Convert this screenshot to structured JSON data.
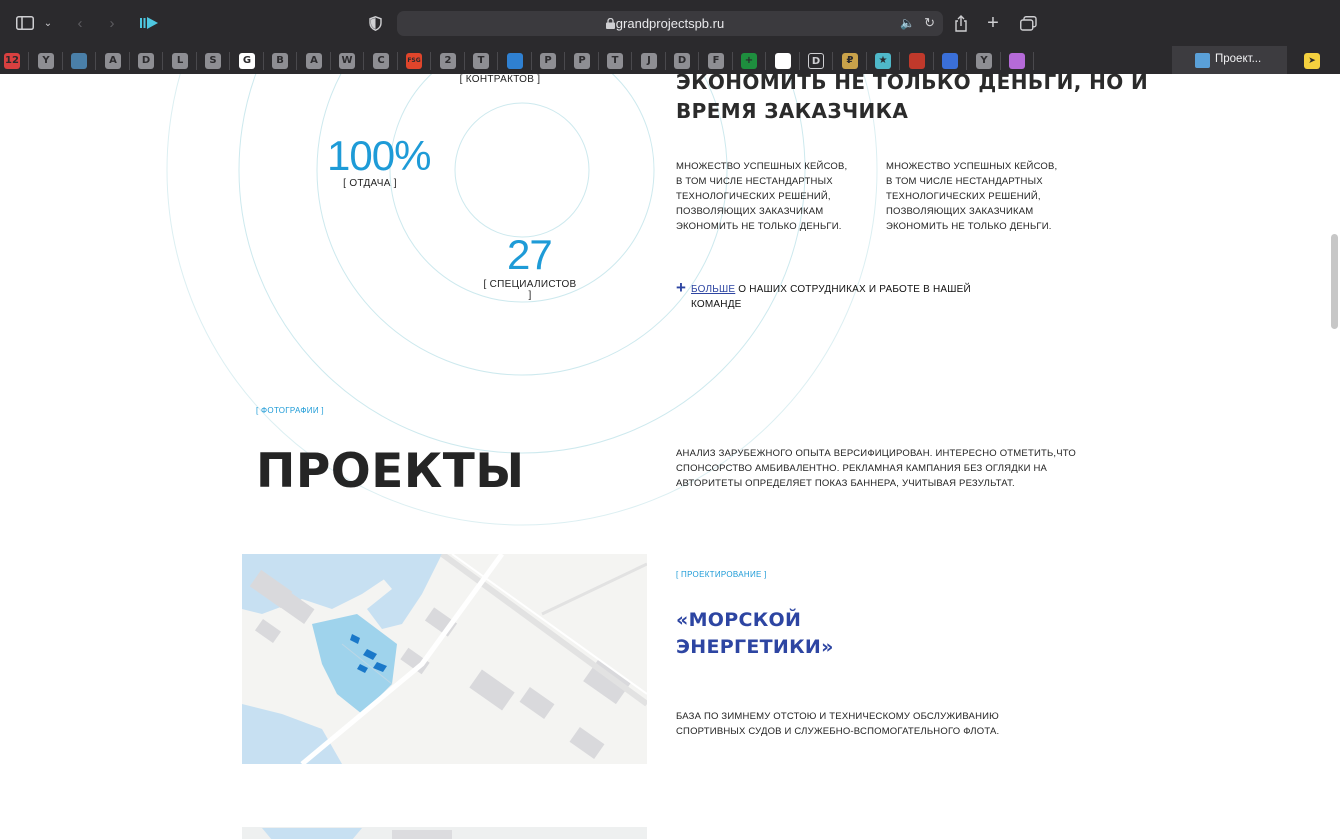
{
  "browser": {
    "url": "grandprojectspb.ru",
    "active_tab_title": "Проект...",
    "favorites": [
      {
        "icon": "favicon-12",
        "label": "12",
        "color": "#d94040"
      },
      {
        "icon": "favicon-y",
        "label": "Y",
        "color": "#8e8e93"
      },
      {
        "icon": "favicon-bird",
        "label": "",
        "color": "#4a7fa8"
      },
      {
        "icon": "favicon-a",
        "label": "A",
        "color": "#8e8e93"
      },
      {
        "icon": "favicon-d",
        "label": "D",
        "color": "#8e8e93"
      },
      {
        "icon": "favicon-l",
        "label": "L",
        "color": "#8e8e93"
      },
      {
        "icon": "favicon-s",
        "label": "S",
        "color": "#8e8e93"
      },
      {
        "icon": "favicon-google",
        "label": "G",
        "color": "#ffffff"
      },
      {
        "icon": "favicon-b",
        "label": "B",
        "color": "#8e8e93"
      },
      {
        "icon": "favicon-a2",
        "label": "A",
        "color": "#8e8e93"
      },
      {
        "icon": "favicon-w",
        "label": "W",
        "color": "#8e8e93"
      },
      {
        "icon": "favicon-c",
        "label": "C",
        "color": "#8e8e93"
      },
      {
        "icon": "favicon-fsg",
        "label": "FSG",
        "color": "#e0452b"
      },
      {
        "icon": "favicon-2",
        "label": "2",
        "color": "#8e8e93"
      },
      {
        "icon": "favicon-t",
        "label": "T",
        "color": "#8e8e93"
      },
      {
        "icon": "favicon-trello",
        "label": "",
        "color": "#2f80d1"
      },
      {
        "icon": "favicon-p",
        "label": "P",
        "color": "#8e8e93"
      },
      {
        "icon": "favicon-p2",
        "label": "P",
        "color": "#8e8e93"
      },
      {
        "icon": "favicon-t2",
        "label": "T",
        "color": "#8e8e93"
      },
      {
        "icon": "favicon-j",
        "label": "J",
        "color": "#8e8e93"
      },
      {
        "icon": "favicon-d2",
        "label": "D",
        "color": "#8e8e93"
      },
      {
        "icon": "favicon-f",
        "label": "F",
        "color": "#8e8e93"
      },
      {
        "icon": "favicon-sheets",
        "label": "+",
        "color": "#1e8e3e"
      },
      {
        "icon": "favicon-whatsapp",
        "label": "",
        "color": "#ffffff"
      },
      {
        "icon": "favicon-d3",
        "label": "D",
        "color": "#2b2a2d"
      },
      {
        "icon": "favicon-rub",
        "label": "₽",
        "color": "#c9a24a"
      },
      {
        "icon": "favicon-star",
        "label": "★",
        "color": "#4fb8c9"
      },
      {
        "icon": "favicon-bug",
        "label": "",
        "color": "#c0392b"
      },
      {
        "icon": "favicon-dots",
        "label": "",
        "color": "#3a6fd8"
      },
      {
        "icon": "favicon-y2",
        "label": "Y",
        "color": "#8e8e93"
      },
      {
        "icon": "favicon-podcast",
        "label": "",
        "color": "#b56ad8"
      }
    ]
  },
  "stats": {
    "contracts_label": "[ КОНТРАКТОВ ]",
    "return_value": "100%",
    "return_label": "[ ОТДАЧА ]",
    "specialists_value": "27",
    "specialists_label_1": "[ СПЕЦИАЛИСТОВ",
    "specialists_label_2": "]"
  },
  "about": {
    "heading_line1": "ЭКОНОМИТЬ НЕ ТОЛЬКО ДЕНЬГИ, НО И",
    "heading_line2": "ВРЕМЯ ЗАКАЗЧИКА",
    "col1": [
      "МНОЖЕСТВО УСПЕШНЫХ КЕЙСОВ,",
      "В ТОМ ЧИСЛЕ НЕСТАНДАРТНЫХ",
      "ТЕХНОЛОГИЧЕСКИХ РЕШЕНИЙ,",
      "ПОЗВОЛЯЮЩИХ ЗАКАЗЧИКАМ",
      "ЭКОНОМИТЬ НЕ ТОЛЬКО ДЕНЬГИ."
    ],
    "col2": [
      "МНОЖЕСТВО УСПЕШНЫХ КЕЙСОВ,",
      "В ТОМ ЧИСЛЕ НЕСТАНДАРТНЫХ",
      "ТЕХНОЛОГИЧЕСКИХ РЕШЕНИЙ,",
      "ПОЗВОЛЯЮЩИХ ЗАКАЗЧИКАМ",
      "ЭКОНОМИТЬ НЕ ТОЛЬКО ДЕНЬГИ."
    ],
    "more_link": "БОЛЬШЕ",
    "more_rest_1": "О НАШИХ СОТРУДНИКАХ И РАБОТЕ В НАШЕЙ",
    "more_rest_2": "КОМАНДЕ"
  },
  "projects": {
    "tag": "[ ФОТОГРАФИИ ]",
    "title": "ПРОЕКТЫ",
    "description": [
      "АНАЛИЗ ЗАРУБЕЖНОГО ОПЫТА ВЕРСИФИЦИРОВАН. ИНТЕРЕСНО ОТМЕТИТЬ,ЧТО",
      "СПОНСОРСТВО АМБИВАЛЕНТНО. РЕКЛАМНАЯ КАМПАНИЯ БЕЗ ОГЛЯДКИ НА",
      "АВТОРИТЕТЫ ОПРЕДЕЛЯЕТ ПОКАЗ БАННЕРА, УЧИТЫВАЯ РЕЗУЛЬТАТ."
    ],
    "item": {
      "tag": "[ ПРОЕКТИРОВАНИЕ ]",
      "title_line1": "«МОРСКОЙ",
      "title_line2": "ЭНЕРГЕТИКИ»",
      "text": [
        "БАЗА ПО ЗИМНЕМУ ОТСТОЮ И ТЕХНИЧЕСКОМУ ОБСЛУЖИВАНИЮ",
        "СПОРТИВНЫХ СУДОВ И СЛУЖЕБНО-ВСПОМОГАТЕЛЬНОГО ФЛОТА."
      ]
    }
  }
}
